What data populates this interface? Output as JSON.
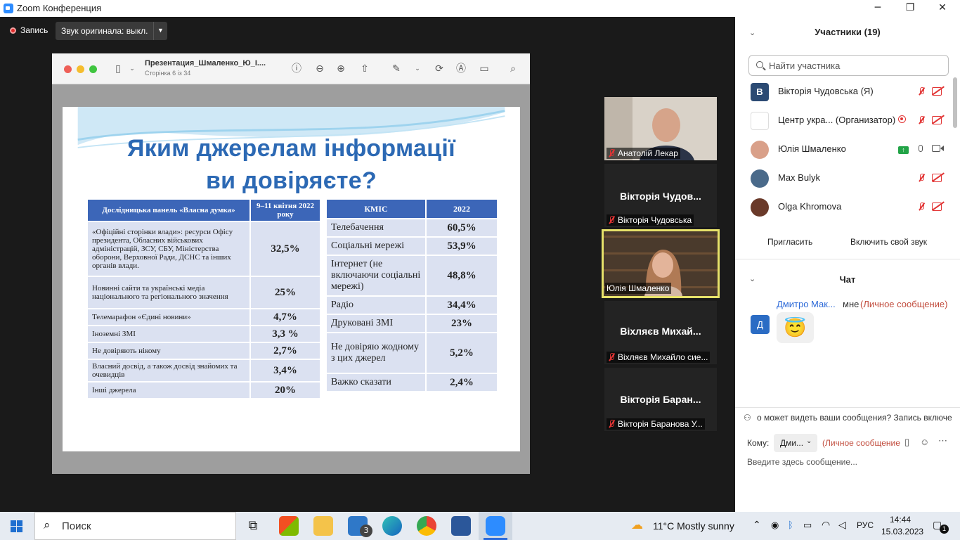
{
  "window": {
    "title": "Zoom Конференция",
    "minimize": "─",
    "restore": "❐",
    "close": "✕"
  },
  "toolbar": {
    "record_label": "Запись",
    "original_sound_label": "Звук оригинала: выкл.",
    "dropdown": "▼"
  },
  "viewer": {
    "doc_title": "Презентация_Шмаленко_Ю_І....",
    "page_info": "Сторінка 6 із 34"
  },
  "slide": {
    "title_line1": "Яким джерелам інформації",
    "title_line2": "ви довіряєте?",
    "left_table": {
      "headers": [
        "Дослідницька панель «Власна думка»",
        "9–11 квітня 2022 року"
      ],
      "rows": [
        {
          "label": "«Офіційні сторінки влади»: ресурси Офісу президента, Обласних військових адміністрацій, ЗСУ, СБУ, Міністерства оборони, Верховної Ради, ДСНС та інших органів влади.",
          "value": "32,5%"
        },
        {
          "label": "Новинні сайти та українські медіа національного та регіонального значення",
          "value": "25%"
        },
        {
          "label": "Телемарафон «Єдині новини»",
          "value": "4,7%"
        },
        {
          "label": "Іноземні ЗМІ",
          "value": "3,3 %"
        },
        {
          "label": "Не довіряють нікому",
          "value": "2,7%"
        },
        {
          "label": "Власний досвід, а також досвід знайомих та очевидців",
          "value": "3,4%"
        },
        {
          "label": "Інші джерела",
          "value": "20%"
        }
      ]
    },
    "right_table": {
      "headers": [
        "КМІС",
        "2022"
      ],
      "rows": [
        {
          "label": "Телебачення",
          "value": "60,5%"
        },
        {
          "label": "Соціальні мережі",
          "value": "53,9%"
        },
        {
          "label": "Інтернет (не включаючи соціальні мережі)",
          "value": "48,8%"
        },
        {
          "label": "Радіо",
          "value": "34,4%"
        },
        {
          "label": "Друковані ЗМІ",
          "value": "23%"
        },
        {
          "label": "Не довіряю жодному з цих джерел",
          "value": "5,2%"
        },
        {
          "label": "Важко сказати",
          "value": "2,4%"
        }
      ]
    }
  },
  "gallery": [
    {
      "caption": "Анатолій Лекар",
      "big_name": ""
    },
    {
      "caption": "Вікторія Чудовська",
      "big_name": "Вікторія Чудов..."
    },
    {
      "caption": "Юлія Шмаленко",
      "big_name": ""
    },
    {
      "caption": "Віхляєв Михайло сие...",
      "big_name": "Віхляєв Михай..."
    },
    {
      "caption": "Вікторія Баранова У...",
      "big_name": "Вікторія Баран..."
    }
  ],
  "participants": {
    "header": "Участники (19)",
    "search_placeholder": "Найти участника",
    "list": [
      {
        "initial": "В",
        "name": "Вікторія Чудовська (Я)",
        "color": "#2b4a73"
      },
      {
        "initial": "",
        "name": "Центр укра... (Организатор)",
        "color": "#ffffff"
      },
      {
        "initial": "",
        "name": "Юлія Шмаленко",
        "color": "#d9a089"
      },
      {
        "initial": "",
        "name": "Max Bulyk",
        "color": "#4a6a8a"
      },
      {
        "initial": "",
        "name": "Olga Khromova",
        "color": "#6a3a2a"
      }
    ],
    "invite_label": "Пригласить",
    "unmute_label": "Включить свой звук"
  },
  "chat": {
    "header": "Чат",
    "message": {
      "avatar_initial": "Д",
      "from": "Дмитро Мак...",
      "to": "мне",
      "private_tag": "(Личное сообщение)",
      "emoji": "😇"
    },
    "notice": "о может видеть ваши сообщения? Запись включе",
    "to_label": "Кому:",
    "to_value": "Дми...",
    "to_private": "(Личное сообщение",
    "input_placeholder": "Введите здесь сообщение..."
  },
  "taskbar": {
    "search_placeholder": "Поиск",
    "mail_badge": "3",
    "weather": "11°C  Mostly sunny",
    "lang": "РУС",
    "time": "14:44",
    "date": "15.03.2023",
    "notif_count": "1"
  },
  "colors": {
    "slide_blue": "#2c69b4",
    "table_header": "#3c66b8",
    "table_row": "#dbe1f1",
    "highlight": "#e7e26a"
  }
}
